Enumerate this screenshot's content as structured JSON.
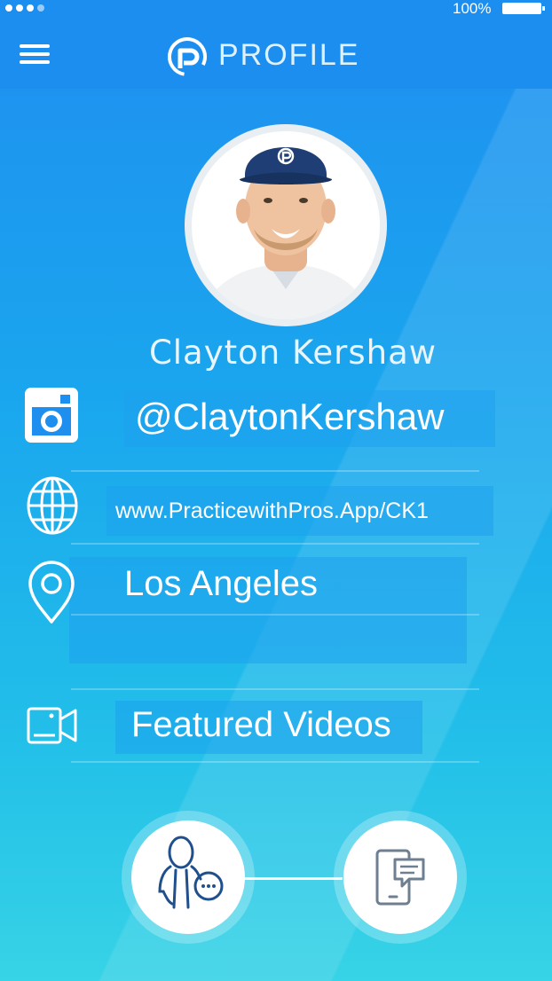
{
  "status_bar": {
    "battery_percent": "100%"
  },
  "header": {
    "title": "PROFILE",
    "menu_icon": "hamburger-menu-icon",
    "logo_icon": "pwp-logo-icon"
  },
  "profile": {
    "name": "Clayton Kershaw",
    "avatar_icon": "avatar-photo",
    "instagram": {
      "icon": "instagram-icon",
      "handle": "@ClaytonKershaw"
    },
    "website": {
      "icon": "globe-icon",
      "url": "www.PracticewithPros.App/CK1"
    },
    "location": {
      "icon": "location-pin-icon",
      "city": "Los Angeles"
    },
    "videos": {
      "icon": "video-camera-icon",
      "label": "Featured Videos"
    }
  },
  "actions": [
    {
      "icon": "person-chat-icon"
    },
    {
      "icon": "phone-message-icon"
    }
  ],
  "colors": {
    "header_bg": "#1c8ef0",
    "gradient_top": "#1f8ff0",
    "gradient_bottom": "#37d3e6",
    "text": "#ffffff"
  }
}
